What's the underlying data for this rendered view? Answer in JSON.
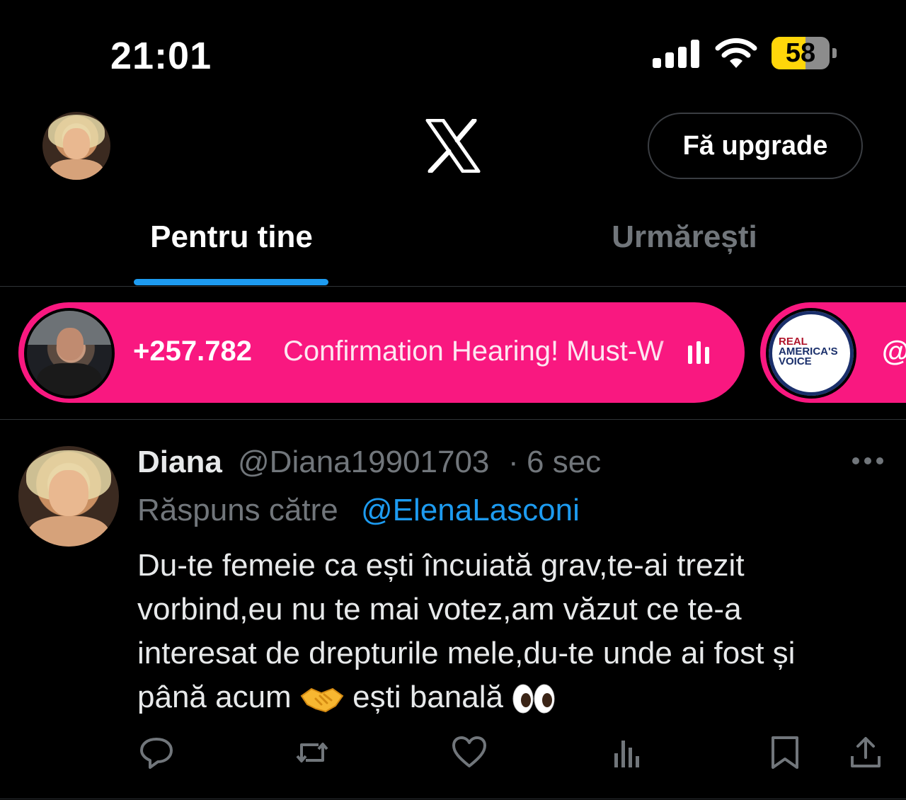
{
  "status_bar": {
    "time": "21:01",
    "battery_level": "58",
    "battery_fraction": 0.58
  },
  "header": {
    "logo": "x-logo",
    "upgrade_label": "Fă upgrade"
  },
  "tabs": [
    {
      "label": "Pentru tine",
      "active": true
    },
    {
      "label": "Urmărești",
      "active": false
    }
  ],
  "spaces": [
    {
      "listeners": "+257.782",
      "title": "Confirmation Hearing! Must-W",
      "icon": "audio-bars-icon"
    },
    {
      "host_logo_text": [
        "REAL",
        "AMERICA'S",
        "VOICE"
      ],
      "handle_start": "@"
    }
  ],
  "tweet": {
    "name": "Diana",
    "handle": "@Diana19901703",
    "separator": "·",
    "time": "6 sec",
    "reply_prefix": "Răspuns către",
    "reply_to": "@ElenaLasconi",
    "lines": [
      "Du-te femeie ca ești încuiată grav,te-ai trezit",
      "vorbind,eu nu te mai votez,am văzut ce te-a",
      "interesat de drepturile mele,du-te unde ai fost și",
      "până acum"
    ],
    "line4_mid": "ești banală",
    "emojis": [
      "handshake",
      "eyes"
    ]
  },
  "actions": [
    "reply-icon",
    "retweet-icon",
    "like-icon",
    "views-icon",
    "bookmark-icon",
    "share-icon"
  ],
  "colors": {
    "accent": "#1d9bf0",
    "spaces_pink": "#f91880",
    "muted": "#71767b",
    "battery_yellow": "#ffd60a"
  }
}
